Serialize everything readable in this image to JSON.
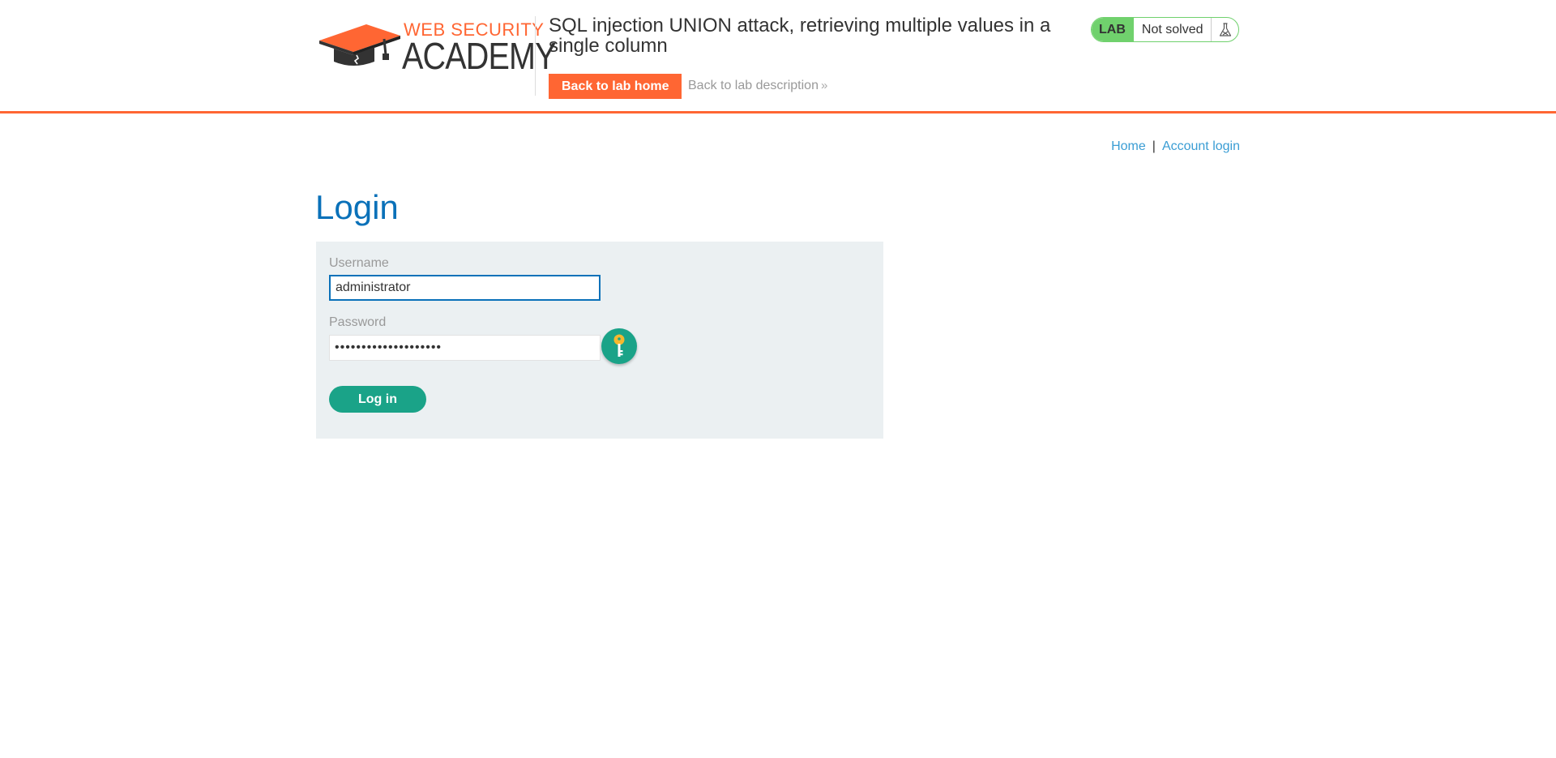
{
  "header": {
    "logo_top": "WEB SECURITY",
    "logo_bottom": "ACADEMY",
    "lab_title": "SQL injection UNION attack, retrieving multiple values in a single column",
    "back_home_label": "Back to lab home",
    "back_description_label": "Back to lab description",
    "lab_badge": "LAB",
    "lab_status": "Not solved"
  },
  "nav": {
    "home_label": "Home",
    "separator": "|",
    "account_login_label": "Account login"
  },
  "main": {
    "title": "Login",
    "username_label": "Username",
    "username_value": "administrator",
    "password_label": "Password",
    "password_value": "••••••••••••••••••••",
    "login_button_label": "Log in"
  },
  "colors": {
    "accent_orange": "#ff6633",
    "heading_blue": "#0a71b9",
    "link_blue": "#3a9dd4",
    "lab_green": "#70d16d",
    "button_teal": "#1aa388",
    "form_bg": "#ebf0f2"
  },
  "icons": {
    "logo": "graduation-cap-icon",
    "lab_status": "flask-icon",
    "password_manager": "key-icon",
    "back_description": "double-chevron-right-icon"
  }
}
